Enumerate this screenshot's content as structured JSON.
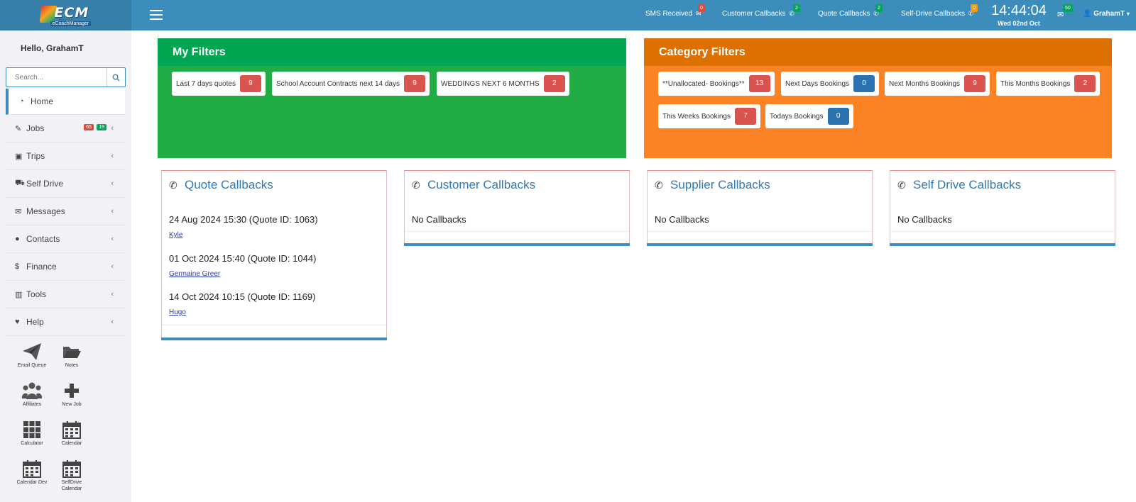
{
  "app": {
    "brand": "ECM",
    "brand_sub": "eCoachManager"
  },
  "topbar": {
    "sms": {
      "label": "SMS Received",
      "count": "0"
    },
    "customer_callbacks": {
      "label": "Customer Callbacks",
      "count": "2"
    },
    "quote_callbacks": {
      "label": "Quote Callbacks",
      "count": "2"
    },
    "selfdrive_callbacks": {
      "label": "Self-Drive Callbacks",
      "count": "0"
    },
    "clock_time": "14:44:04",
    "clock_date": "Wed 02nd Oct",
    "mail_count": "50",
    "user": "GrahamT"
  },
  "sidebar": {
    "greeting": "Hello, GrahamT",
    "search_placeholder": "Search...",
    "items": [
      {
        "label": "Home",
        "icon": "dashboard-icon"
      },
      {
        "label": "Jobs",
        "icon": "edit-icon",
        "badge_a": "65",
        "badge_b": "19"
      },
      {
        "label": "Trips",
        "icon": "briefcase-icon"
      },
      {
        "label": "Self Drive",
        "icon": "car-icon"
      },
      {
        "label": "Messages",
        "icon": "envelope-icon"
      },
      {
        "label": "Contacts",
        "icon": "user-icon"
      },
      {
        "label": "Finance",
        "icon": "dollar-icon"
      },
      {
        "label": "Tools",
        "icon": "bar-chart-icon"
      },
      {
        "label": "Help",
        "icon": "heart-icon"
      }
    ],
    "shortcuts": [
      {
        "label": "Email Queue",
        "icon": "paper-plane-icon"
      },
      {
        "label": "Notes",
        "icon": "folder-open-icon"
      },
      {
        "label": "Affiliates",
        "icon": "users-icon"
      },
      {
        "label": "New Job",
        "icon": "plus-icon"
      },
      {
        "label": "Calculator",
        "icon": "calculator-icon"
      },
      {
        "label": "Calendar",
        "icon": "calendar-icon"
      },
      {
        "label": "Calendar Dev",
        "icon": "calendar-dev-icon"
      },
      {
        "label": "SelfDrive Calendar",
        "icon": "selfdrive-calendar-icon"
      }
    ]
  },
  "my_filters": {
    "title": "My Filters",
    "chips": [
      {
        "label": "Last 7 days quotes",
        "count": "9"
      },
      {
        "label": "School Account Contracts next 14 days",
        "count": "9"
      },
      {
        "label": "WEDDINGS NEXT 6 MONTHS",
        "count": "2"
      }
    ]
  },
  "category_filters": {
    "title": "Category Filters",
    "chips": [
      {
        "label": "**Unallocated- Bookings**",
        "count": "13"
      },
      {
        "label": "Next Days Bookings",
        "count": "0"
      },
      {
        "label": "Next Months Bookings",
        "count": "9"
      },
      {
        "label": "This Months Bookings",
        "count": "2"
      },
      {
        "label": "This Weeks Bookings",
        "count": "7"
      },
      {
        "label": "Todays Bookings",
        "count": "0"
      }
    ]
  },
  "callbacks": {
    "quote": {
      "title": "Quote Callbacks",
      "entries": [
        {
          "when": "24 Aug 2024 15:30 (Quote ID: 1063)",
          "who": "Kyle"
        },
        {
          "when": "01 Oct 2024 15:40 (Quote ID: 1044)",
          "who": "Germaine Greer"
        },
        {
          "when": "14 Oct 2024 10:15 (Quote ID: 1169)",
          "who": "Hugo"
        }
      ]
    },
    "customer": {
      "title": "Customer Callbacks",
      "empty": "No Callbacks"
    },
    "supplier": {
      "title": "Supplier Callbacks",
      "empty": "No Callbacks"
    },
    "selfdrive": {
      "title": "Self Drive Callbacks",
      "empty": "No Callbacks"
    }
  },
  "colors": {
    "topbar": "#3c8dbc",
    "green_panel": "#22ac46",
    "orange_panel": "#fc8226",
    "badge_red": "#d9534f",
    "badge_blue": "#2b72b0"
  }
}
